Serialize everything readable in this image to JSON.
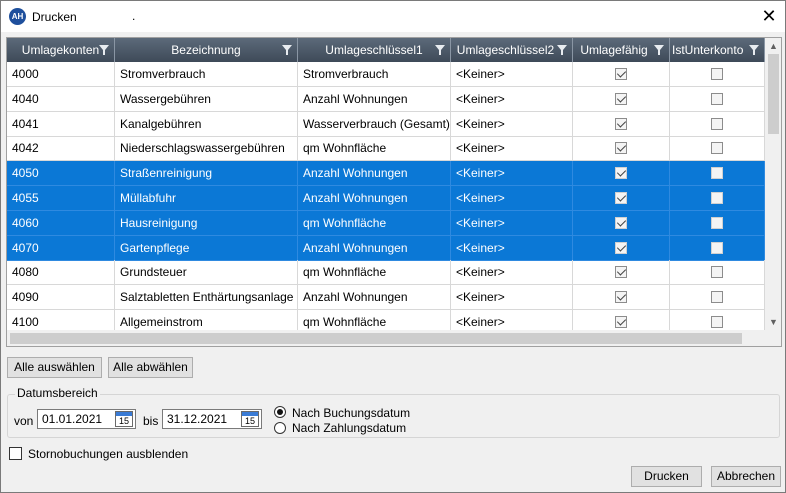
{
  "window": {
    "title": "Drucken",
    "title_suffix": ".",
    "app_icon": "AH",
    "close_glyph": "✕"
  },
  "table": {
    "columns": [
      "Umlagekonten",
      "Bezeichnung",
      "Umlageschlüssel1",
      "Umlageschlüssel2",
      "Umlagefähig",
      "IstUnterkonto"
    ],
    "rows": [
      {
        "konto": "4000",
        "bezeichnung": "Stromverbrauch",
        "schluessel1": "Stromverbrauch",
        "schluessel2": "<Keiner>",
        "umlagefaehig": true,
        "unterkonto": false,
        "selected": false
      },
      {
        "konto": "4040",
        "bezeichnung": "Wassergebühren",
        "schluessel1": "Anzahl Wohnungen",
        "schluessel2": "<Keiner>",
        "umlagefaehig": true,
        "unterkonto": false,
        "selected": false
      },
      {
        "konto": "4041",
        "bezeichnung": "Kanalgebühren",
        "schluessel1": "Wasserverbrauch (Gesamt)",
        "schluessel2": "<Keiner>",
        "umlagefaehig": true,
        "unterkonto": false,
        "selected": false
      },
      {
        "konto": "4042",
        "bezeichnung": "Niederschlagswassergebühren",
        "schluessel1": "qm Wohnfläche",
        "schluessel2": "<Keiner>",
        "umlagefaehig": true,
        "unterkonto": false,
        "selected": false
      },
      {
        "konto": "4050",
        "bezeichnung": "Straßenreinigung",
        "schluessel1": "Anzahl Wohnungen",
        "schluessel2": "<Keiner>",
        "umlagefaehig": true,
        "unterkonto": false,
        "selected": true
      },
      {
        "konto": "4055",
        "bezeichnung": "Müllabfuhr",
        "schluessel1": "Anzahl Wohnungen",
        "schluessel2": "<Keiner>",
        "umlagefaehig": true,
        "unterkonto": false,
        "selected": true
      },
      {
        "konto": "4060",
        "bezeichnung": "Hausreinigung",
        "schluessel1": "qm Wohnfläche",
        "schluessel2": "<Keiner>",
        "umlagefaehig": true,
        "unterkonto": false,
        "selected": true
      },
      {
        "konto": "4070",
        "bezeichnung": "Gartenpflege",
        "schluessel1": "Anzahl Wohnungen",
        "schluessel2": "<Keiner>",
        "umlagefaehig": true,
        "unterkonto": false,
        "selected": true
      },
      {
        "konto": "4080",
        "bezeichnung": "Grundsteuer",
        "schluessel1": "qm Wohnfläche",
        "schluessel2": "<Keiner>",
        "umlagefaehig": true,
        "unterkonto": false,
        "selected": false
      },
      {
        "konto": "4090",
        "bezeichnung": "Salztabletten Enthärtungsanlage",
        "schluessel1": "Anzahl Wohnungen",
        "schluessel2": "<Keiner>",
        "umlagefaehig": true,
        "unterkonto": false,
        "selected": false
      },
      {
        "konto": "4100",
        "bezeichnung": "Allgemeinstrom",
        "schluessel1": "qm Wohnfläche",
        "schluessel2": "<Keiner>",
        "umlagefaehig": true,
        "unterkonto": false,
        "selected": false
      }
    ],
    "selection_color": "#0b78d6"
  },
  "buttons": {
    "select_all": "Alle auswählen",
    "deselect_all": "Alle abwählen",
    "print": "Drucken",
    "cancel": "Abbrechen"
  },
  "date_range": {
    "group_label": "Datumsbereich",
    "from_label": "von",
    "from_value": "01.01.2021",
    "to_label": "bis",
    "to_value": "31.12.2021",
    "calendar_day": "15"
  },
  "date_mode": {
    "booking_label": "Nach Buchungsdatum",
    "payment_label": "Nach Zahlungsdatum",
    "selected": "booking"
  },
  "hide_storno": {
    "label": "Stornobuchungen ausblenden",
    "checked": false
  }
}
